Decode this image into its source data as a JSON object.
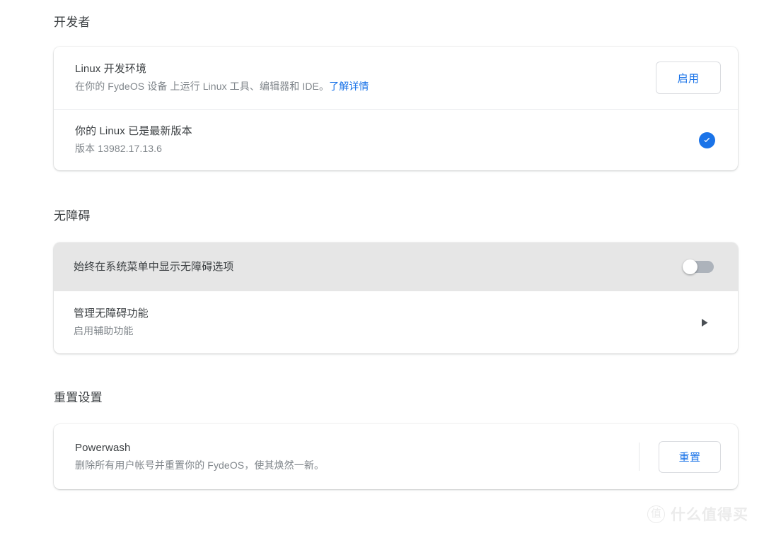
{
  "sections": {
    "developer": {
      "title": "开发者",
      "rows": {
        "linux_env": {
          "title": "Linux 开发环境",
          "subtitle_before_link": "在你的 FydeOS 设备 上运行 Linux 工具、编辑器和 IDE。",
          "link_label": "了解详情",
          "action_label": "启用"
        },
        "linux_version": {
          "title": "你的 Linux 已是最新版本",
          "subtitle": "版本 13982.17.13.6",
          "status_icon": "check-circle-icon"
        }
      }
    },
    "accessibility": {
      "title": "无障碍",
      "rows": {
        "show_in_menu": {
          "title": "始终在系统菜单中显示无障碍选项",
          "toggle_state": "off"
        },
        "manage": {
          "title": "管理无障碍功能",
          "subtitle": "启用辅助功能",
          "chevron_icon": "triangle-right-icon"
        }
      }
    },
    "reset": {
      "title": "重置设置",
      "rows": {
        "powerwash": {
          "title": "Powerwash",
          "subtitle": "删除所有用户帐号并重置你的 FydeOS，使其焕然一新。",
          "action_label": "重置"
        }
      }
    }
  },
  "watermark": {
    "badge": "值",
    "text": "什么值得买"
  },
  "colors": {
    "accent_blue": "#1a73e8",
    "text_primary": "#3c4043",
    "text_secondary": "#80868b",
    "row_highlight": "#e6e6e6",
    "divider": "#e8eaed",
    "page_background": "#ffffff"
  }
}
